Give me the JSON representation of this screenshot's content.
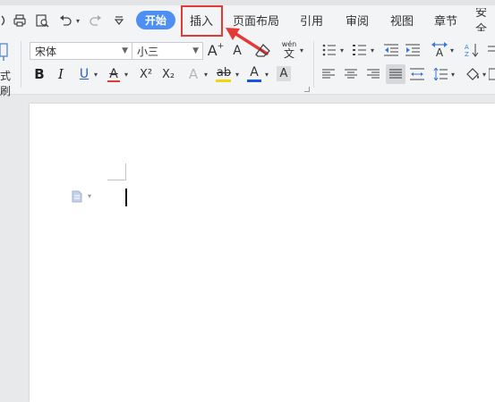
{
  "tabs": {
    "start": "开始",
    "insert": "插入",
    "page_layout": "页面布局",
    "references": "引用",
    "review": "审阅",
    "view": "视图",
    "chapter": "章节",
    "security": "安全"
  },
  "font": {
    "family": "宋体",
    "size": "小三"
  },
  "left_panel": {
    "format_painter_label": "式刷"
  },
  "glyphs": {
    "bold": "B",
    "italic": "I",
    "underline": "U",
    "strike": "A",
    "superscript": "X²",
    "subscript": "X₂",
    "text_effect": "A",
    "highlight": "ab",
    "font_color": "A",
    "char_shading": "A",
    "grow_font": "A",
    "shrink_font": "A",
    "phonetic": "wén",
    "text_direction": "A"
  },
  "colors": {
    "active_tab": "#4e8ff4",
    "highlight_box": "#e53935",
    "arrow": "#e53935",
    "underline_red": "#e53935",
    "font_color_blue": "#1a56db",
    "highlight_yellow": "#f5d50a"
  }
}
